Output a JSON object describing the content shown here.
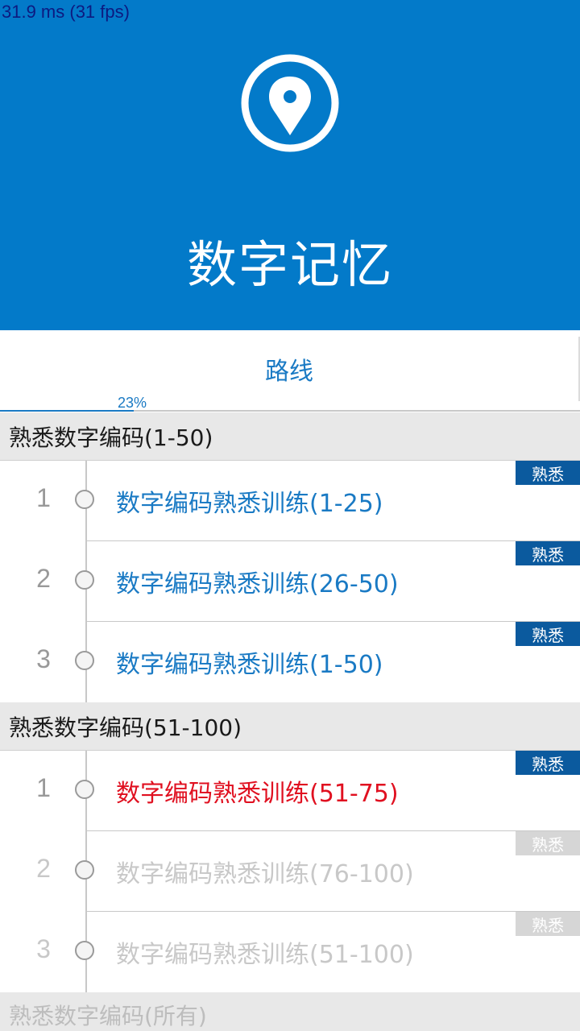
{
  "status": {
    "fps_text": "31.9 ms (31 fps)"
  },
  "header": {
    "title": "数字记忆",
    "icon": "map-pin-icon",
    "background": "#037ac9"
  },
  "tabs": [
    {
      "label": "路线"
    }
  ],
  "progress": {
    "value": 0.23,
    "label": "23%"
  },
  "sections": [
    {
      "title": "熟悉数字编码(1-50)",
      "items": [
        {
          "index": "1",
          "label": "数字编码熟悉训练(1-25)",
          "badge": "熟悉",
          "state": "done"
        },
        {
          "index": "2",
          "label": "数字编码熟悉训练(26-50)",
          "badge": "熟悉",
          "state": "done"
        },
        {
          "index": "3",
          "label": "数字编码熟悉训练(1-50)",
          "badge": "熟悉",
          "state": "done"
        }
      ]
    },
    {
      "title": "熟悉数字编码(51-100)",
      "items": [
        {
          "index": "1",
          "label": "数字编码熟悉训练(51-75)",
          "badge": "熟悉",
          "state": "current"
        },
        {
          "index": "2",
          "label": "数字编码熟悉训练(76-100)",
          "badge": "熟悉",
          "state": "locked"
        },
        {
          "index": "3",
          "label": "数字编码熟悉训练(51-100)",
          "badge": "熟悉",
          "state": "locked"
        }
      ]
    },
    {
      "title": "熟悉数字编码(所有)",
      "items": []
    }
  ],
  "colors": {
    "accent": "#1a7ac4",
    "current": "#e01020",
    "badge": "#0b5a9e",
    "locked": "#c8c8c8"
  }
}
